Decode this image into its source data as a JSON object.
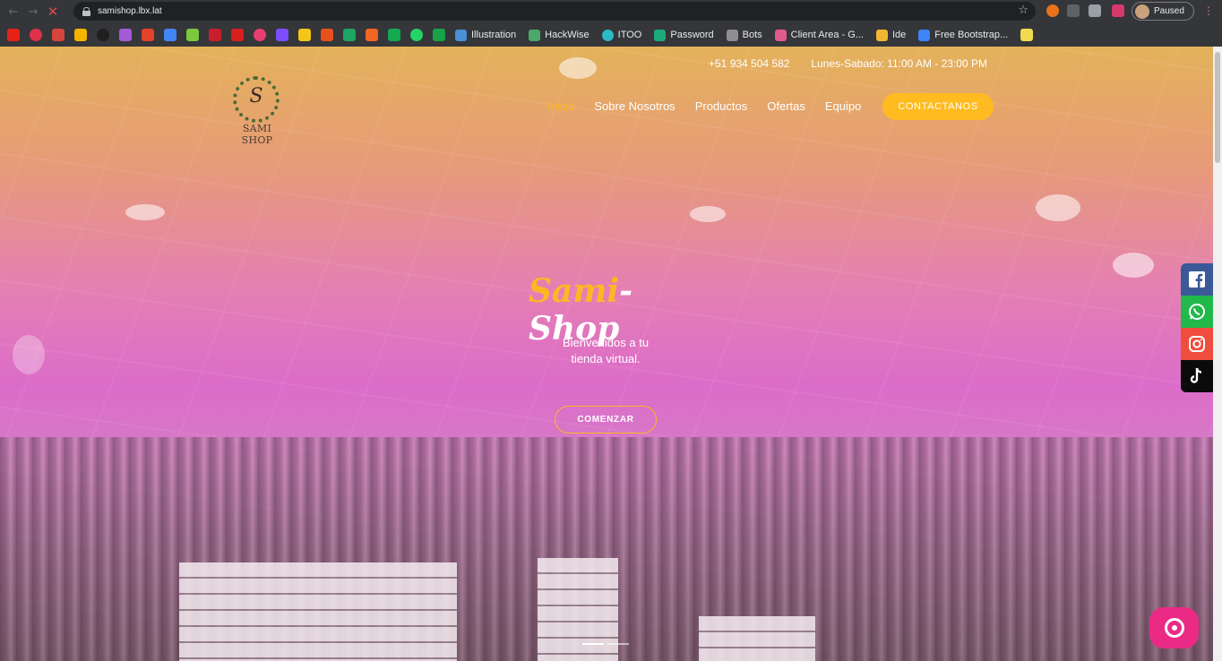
{
  "browser": {
    "url": "samishop.lbx.lat",
    "profile_label": "Paused",
    "bookmarks": [
      {
        "label": "Illustration",
        "color": "#4a90d9"
      },
      {
        "label": "HackWise",
        "color": "#4aa86b"
      },
      {
        "label": "ITOO",
        "color": "#2cbac7"
      },
      {
        "label": "Password",
        "color": "#1bab7a"
      },
      {
        "label": "Bots",
        "color": "#8e8e93"
      },
      {
        "label": "Client Area - G...",
        "color": "#e05a8a"
      },
      {
        "label": "Ide",
        "color": "#f2b632"
      },
      {
        "label": "Free Bootstrap...",
        "color": "#3f83f8"
      }
    ]
  },
  "header": {
    "phone": "+51 934 504 582",
    "hours": "Lunes-Sabado: 11:00 AM - 23:00 PM",
    "logo_initial": "S",
    "logo_name": "SAMI SHOP",
    "nav": [
      "Inicio",
      "Sobre Nosotros",
      "Productos",
      "Ofertas",
      "Equipo"
    ],
    "cta": "CONTACTANOS"
  },
  "hero": {
    "title_part1": "Sami",
    "title_part2": "-Shop",
    "subtitle": "Bienvenidos a tu tienda virtual.",
    "button": "COMENZAR"
  },
  "social": [
    "facebook-icon",
    "whatsapp-icon",
    "instagram-icon",
    "tiktok-icon"
  ],
  "colors": {
    "accent": "#ffb624",
    "chat": "#eb2a86"
  }
}
